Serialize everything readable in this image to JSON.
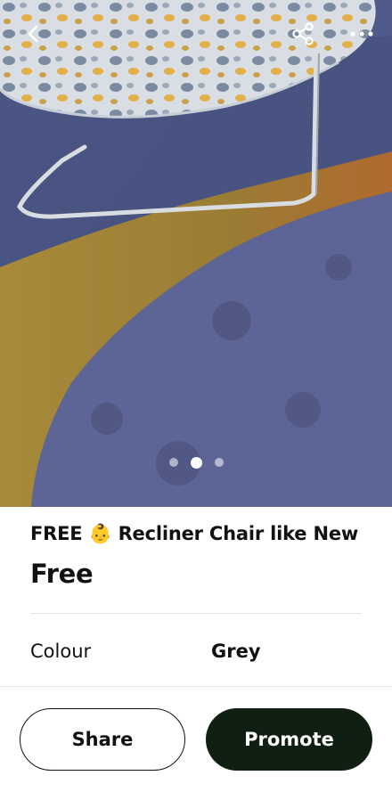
{
  "photo": {
    "carousel": {
      "total": 3,
      "active_index": 1
    }
  },
  "header": {
    "back_icon": "chevron-left-icon",
    "share_icon": "share-icon",
    "more_icon": "more-horizontal-icon"
  },
  "listing": {
    "title": "FREE 👶 Recliner Chair like New",
    "price": "Free",
    "attributes": [
      {
        "label": "Colour",
        "value": "Grey"
      }
    ]
  },
  "actions": {
    "share_label": "Share",
    "promote_label": "Promote"
  },
  "colors": {
    "primary_button": "#0f1f12",
    "text": "#111111"
  }
}
